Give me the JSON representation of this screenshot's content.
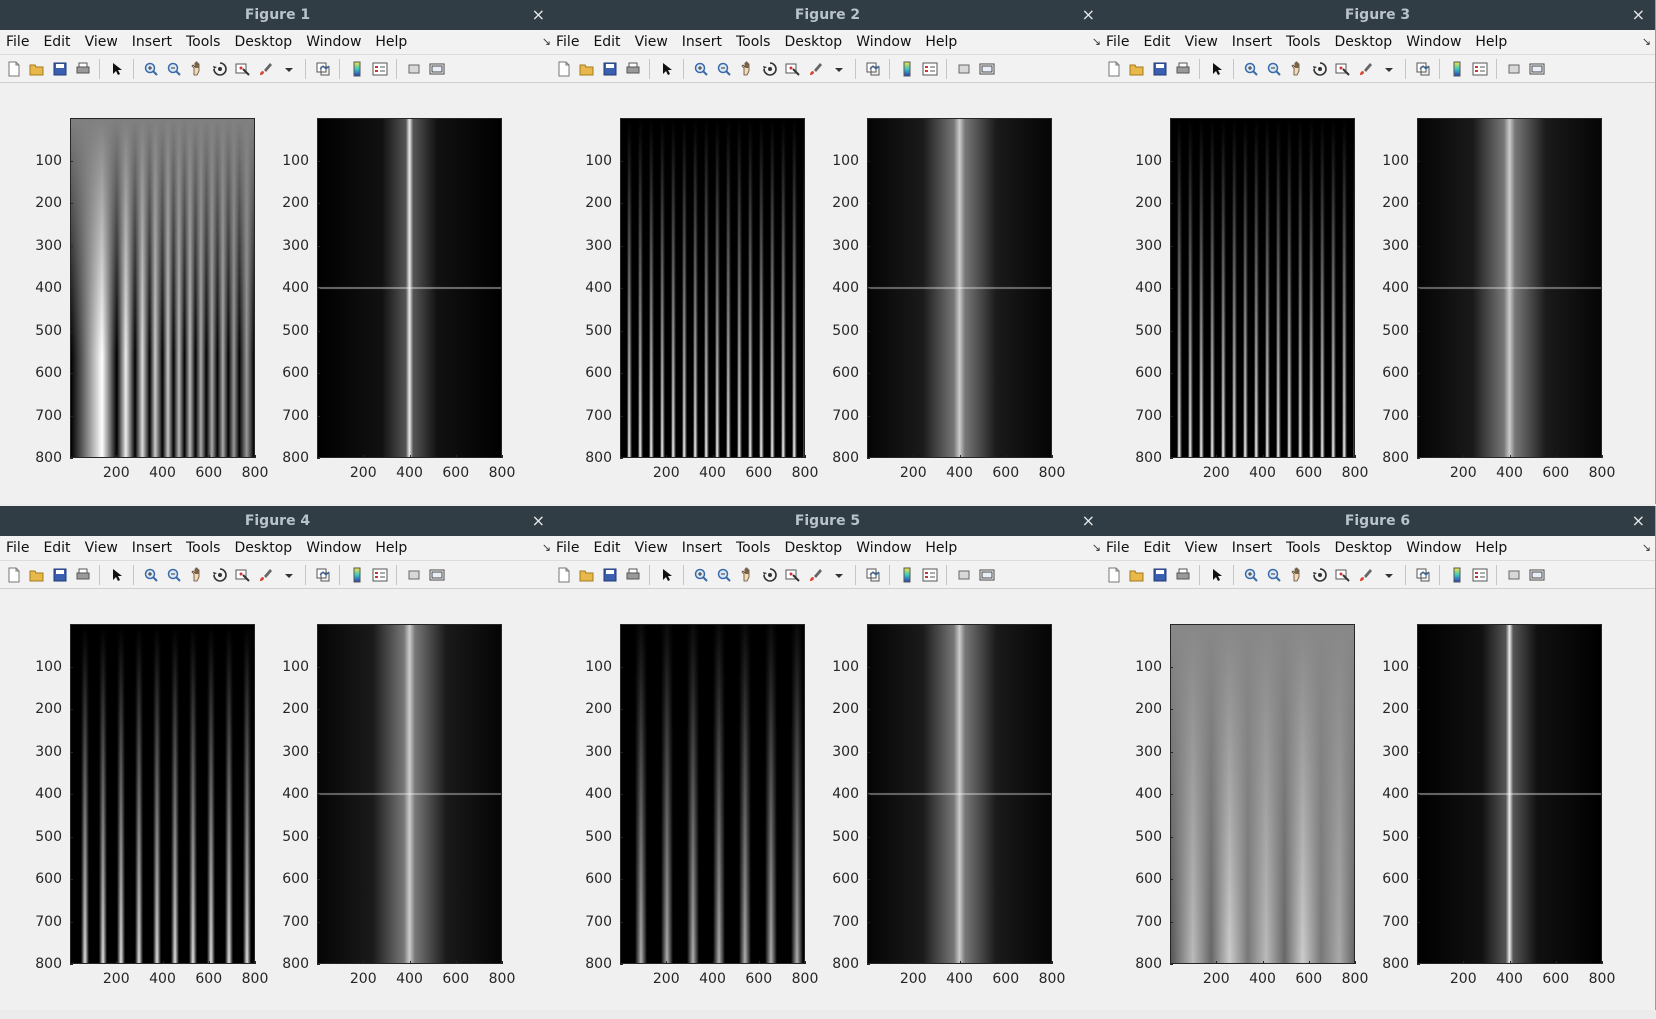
{
  "menu_labels": [
    "File",
    "Edit",
    "View",
    "Insert",
    "Tools",
    "Desktop",
    "Window",
    "Help"
  ],
  "close_glyph": "×",
  "dock_glyph": "↘",
  "toolbar_icons": [
    "new-figure-icon",
    "open-file-icon",
    "save-icon",
    "print-icon",
    "separator",
    "edit-plot-arrow-icon",
    "separator",
    "zoom-in-icon",
    "zoom-out-icon",
    "pan-hand-icon",
    "rotate-3d-icon",
    "data-cursor-icon",
    "brush-icon",
    "brush-dropdown-icon",
    "separator",
    "link-plot-icon",
    "separator",
    "insert-colorbar-icon",
    "insert-legend-icon",
    "separator",
    "hide-plot-tools-icon",
    "show-plot-tools-icon"
  ],
  "y_ticks": [
    "100",
    "200",
    "300",
    "400",
    "500",
    "600",
    "700",
    "800"
  ],
  "x_ticks": [
    "200",
    "400",
    "600",
    "800"
  ],
  "figures": [
    {
      "title": "Figure 1",
      "left_image": "chirp",
      "right_image": "spectrum-centered"
    },
    {
      "title": "Figure 2",
      "left_image": "chirp-dark",
      "right_image": "spectrum-broad"
    },
    {
      "title": "Figure 3",
      "left_image": "chirp-dark",
      "right_image": "spectrum-broad"
    },
    {
      "title": "Figure 4",
      "left_image": "stripes",
      "right_image": "spectrum-broad"
    },
    {
      "title": "Figure 5",
      "left_image": "stripes-faded",
      "right_image": "spectrum-broad"
    },
    {
      "title": "Figure 6",
      "left_image": "smooth-gray",
      "right_image": "spectrum-centered"
    }
  ]
}
